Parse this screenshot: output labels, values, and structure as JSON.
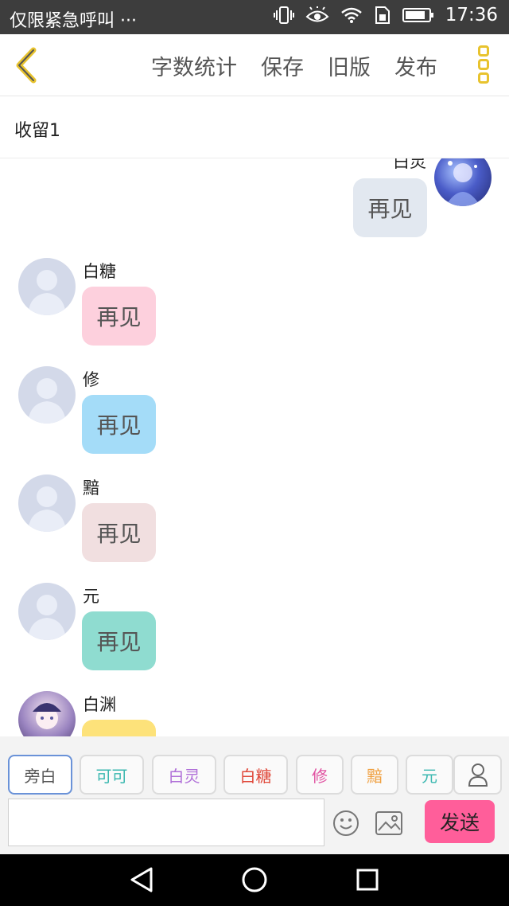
{
  "status_bar": {
    "left_text": "仅限紧急呼叫 ···",
    "time": "17:36",
    "icons": [
      "vibrate-icon",
      "eye-icon",
      "wifi-icon",
      "sim-icon",
      "battery-icon"
    ]
  },
  "toolbar": {
    "back_icon": "chevron-left-icon",
    "actions": [
      "字数统计",
      "保存",
      "旧版",
      "发布"
    ],
    "more_icon": "more-vertical-icon",
    "accent": "#e8c32e"
  },
  "chapter": {
    "title": "收留1"
  },
  "messages": [
    {
      "name": "白灵",
      "text": "再见",
      "side": "right",
      "bubble_color": "#e2e8f0",
      "avatar": "anime-avatar-blue"
    },
    {
      "name": "白糖",
      "text": "再见",
      "side": "left",
      "bubble_color": "#fdd0dd",
      "avatar": "default-avatar"
    },
    {
      "name": "修",
      "text": "再见",
      "side": "left",
      "bubble_color": "#a4dcf8",
      "avatar": "default-avatar"
    },
    {
      "name": "黯",
      "text": "再见",
      "side": "left",
      "bubble_color": "#f1dfe0",
      "avatar": "default-avatar"
    },
    {
      "name": "元",
      "text": "再见",
      "side": "left",
      "bubble_color": "#8fdcd0",
      "avatar": "default-avatar"
    },
    {
      "name": "白渊",
      "text": "",
      "side": "left",
      "bubble_color": "#fde27a",
      "avatar": "anime-avatar-purple"
    }
  ],
  "role_tabs": [
    {
      "label": "旁白",
      "color": "#555555",
      "active": true
    },
    {
      "label": "可可",
      "color": "#3bb8b0",
      "active": false
    },
    {
      "label": "白灵",
      "color": "#b070d8",
      "active": false
    },
    {
      "label": "白糖",
      "color": "#e0483a",
      "active": false
    },
    {
      "label": "修",
      "color": "#e050a0",
      "active": false
    },
    {
      "label": "黯",
      "color": "#f0a040",
      "active": false
    },
    {
      "label": "元",
      "color": "#3bb8b0",
      "active": false
    }
  ],
  "input": {
    "value": "",
    "placeholder": ""
  },
  "send_label": "发送",
  "send_color": "#ff5e9a",
  "bottom_icons": [
    "emoji-icon",
    "image-icon",
    "user-icon"
  ],
  "nav_icons": [
    "nav-back-icon",
    "nav-home-icon",
    "nav-recent-icon"
  ]
}
